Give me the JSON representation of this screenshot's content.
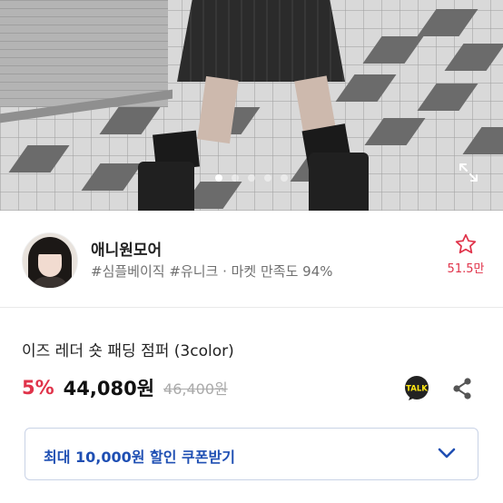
{
  "hero": {
    "dot_count": 5,
    "active_dot": 0,
    "expand_icon": "expand-icon"
  },
  "store": {
    "name": "애니원모어",
    "tags": "#심플베이직 #유니크 · 마켓 만족도 94%",
    "favorite_icon": "star-outline-icon",
    "favorite_count": "51.5만"
  },
  "product": {
    "title": "이즈 레더 숏 패딩 점퍼 (3color)",
    "discount": "5%",
    "price": "44,080원",
    "original_price": "46,400원",
    "talk_badge": "TALK",
    "share_icon": "share-icon"
  },
  "coupon": {
    "label": "최대 10,000원 할인 쿠폰받기",
    "chevron_icon": "chevron-down-icon"
  },
  "colors": {
    "accent_red": "#e0334a",
    "coupon_blue": "#1f4fb3",
    "coupon_border": "#c9d3e6"
  }
}
